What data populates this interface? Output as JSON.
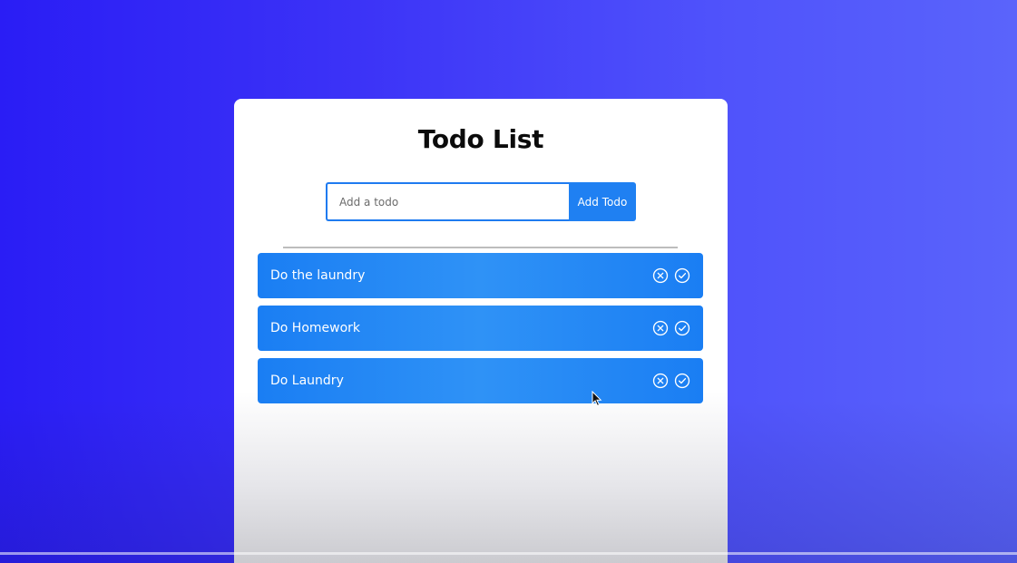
{
  "app": {
    "title": "Todo List"
  },
  "form": {
    "input_value": "",
    "input_placeholder": "Add a todo",
    "add_button_label": "Add Todo"
  },
  "todos": [
    {
      "text": "Do the laundry",
      "delete_icon": "circle-x-icon",
      "complete_icon": "circle-check-icon"
    },
    {
      "text": "Do Homework",
      "delete_icon": "circle-x-icon",
      "complete_icon": "circle-check-icon"
    },
    {
      "text": "Do Laundry",
      "delete_icon": "circle-x-icon",
      "complete_icon": "circle-check-icon"
    }
  ],
  "colors": {
    "background_start": "#2a1df5",
    "background_end": "#5a64fb",
    "accent": "#1f80f2",
    "item_text": "#ffffff",
    "title_text": "#0b0b0b"
  }
}
